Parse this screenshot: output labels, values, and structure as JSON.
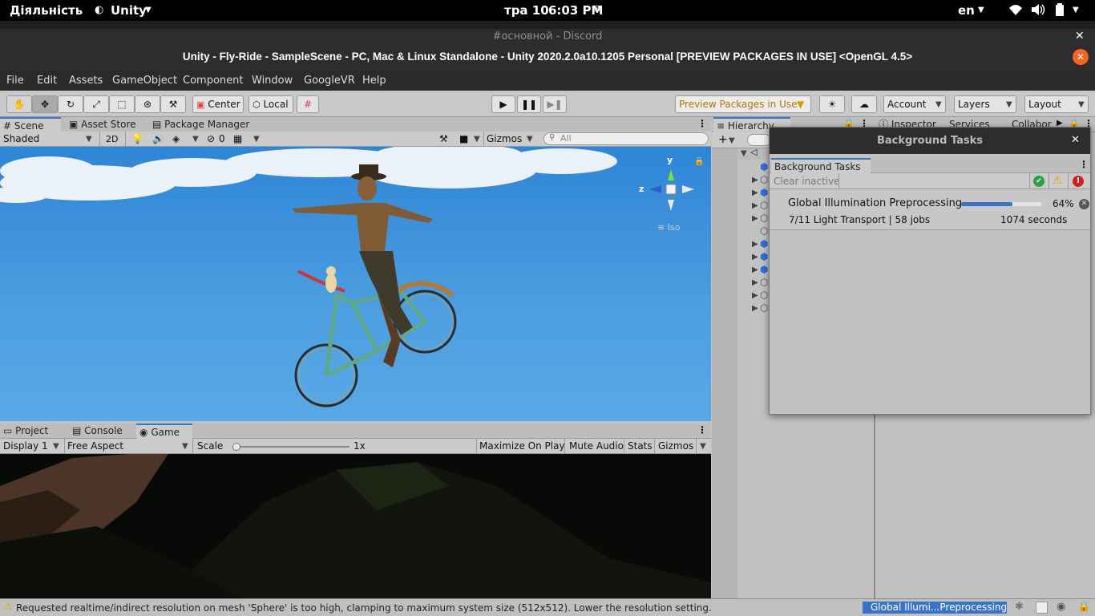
{
  "topbar": {
    "activities": "Діяльність",
    "app": "Unity",
    "date": "тра 10",
    "time": "6:03 PM",
    "lang": "en"
  },
  "discord_title": "#основной - Discord",
  "window_title": "Unity - Fly-Ride - SampleScene - PC, Mac & Linux Standalone - Unity 2020.2.0a10.1205 Personal [PREVIEW PACKAGES IN USE] <OpenGL 4.5>",
  "menu": [
    "File",
    "Edit",
    "Assets",
    "GameObject",
    "Component",
    "Window",
    "GoogleVR",
    "Help"
  ],
  "toolbar": {
    "center": "Center",
    "local": "Local",
    "preview_packages": "Preview Packages in Use",
    "account": "Account",
    "layers": "Layers",
    "layout": "Layout"
  },
  "scene_tabs": [
    "Scene",
    "Asset Store",
    "Package Manager"
  ],
  "scene_bar": {
    "shaded": "Shaded",
    "mode_2d": "2D",
    "hidden_count": "0",
    "gizmos": "Gizmos",
    "search_placeholder": "All"
  },
  "gizmo": {
    "y": "y",
    "z": "z",
    "iso": "Iso"
  },
  "bottom_tabs": [
    "Project",
    "Console",
    "Game"
  ],
  "game_bar": {
    "display": "Display 1",
    "aspect": "Free Aspect",
    "scale_label": "Scale",
    "scale_value": "1x",
    "scale_fraction": 0.0,
    "maximize": "Maximize On Play",
    "mute": "Mute Audio",
    "stats": "Stats",
    "gizmos": "Gizmos"
  },
  "right_tabs": {
    "hierarchy": "Hierarchy",
    "inspector": "Inspector",
    "services": "Services",
    "collab": "Collabor"
  },
  "bg_tasks": {
    "window_title": "Background Tasks",
    "tab": "Background Tasks",
    "clear_inactive": "Clear inactive",
    "task_name": "Global Illumination Preprocessing",
    "task_percent": "64%",
    "progress": 0.64,
    "task_detail": "7/11 Light Transport | 58 jobs",
    "task_time": "1074 seconds"
  },
  "status": {
    "message": "Requested realtime/indirect resolution on mesh 'Sphere' is too high, clamping to maximum system size (512x512). Lower the resolution setting.",
    "progress_label": "Global Illumi...Preprocessing"
  },
  "colors": {
    "accent": "#3a72c8",
    "warning": "#e0a800",
    "error": "#d42020",
    "ok": "#2ea043",
    "close_orange": "#f26522"
  }
}
